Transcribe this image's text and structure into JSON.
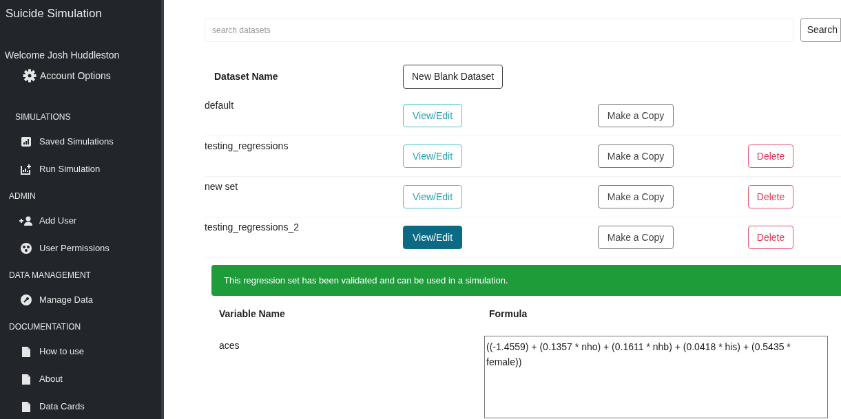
{
  "sidebar": {
    "title": "Suicide Simulation",
    "welcome": "Welcome Josh Huddleston",
    "account_option": "Account Options",
    "sections": [
      {
        "heading": "SIMULATIONS",
        "items": [
          {
            "label": "Saved Simulations"
          },
          {
            "label": "Run Simulation"
          }
        ]
      },
      {
        "heading": "ADMIN",
        "items": [
          {
            "label": "Add User"
          },
          {
            "label": "User Permissions"
          }
        ]
      },
      {
        "heading": "DATA MANAGEMENT",
        "items": [
          {
            "label": "Manage Data"
          }
        ]
      },
      {
        "heading": "DOCUMENTATION",
        "items": [
          {
            "label": "How to use"
          },
          {
            "label": "About"
          },
          {
            "label": "Data Cards"
          }
        ]
      }
    ]
  },
  "search": {
    "placeholder": "search datasets",
    "button": "Search"
  },
  "datasets": {
    "column": "Dataset Name",
    "new_button": "New Blank Dataset",
    "rows": [
      {
        "name": "default",
        "selected": false,
        "view": "View/Edit",
        "copy": "Make a Copy"
      },
      {
        "name": "testing_regressions",
        "selected": false,
        "view": "View/Edit",
        "copy": "Make a Copy",
        "delete": "Delete"
      },
      {
        "name": "new set",
        "selected": false,
        "view": "View/Edit",
        "copy": "Make a Copy",
        "delete": "Delete"
      },
      {
        "name": "testing_regressions_2",
        "selected": true,
        "view": "View/Edit",
        "copy": "Make a Copy",
        "delete": "Delete"
      }
    ]
  },
  "alert": "This regression set has been validated and can be used in a simulation.",
  "regressions": {
    "columns": [
      "Variable Name",
      "Formula"
    ],
    "rows": [
      {
        "variable": "aces",
        "formula": "((-1.4559) + (0.1357 * nho) + (0.1611 * nhb) + (0.0418 * his) + (0.5435 * female))"
      }
    ]
  }
}
